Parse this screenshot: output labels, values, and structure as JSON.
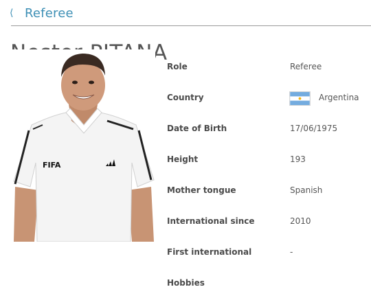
{
  "nav": {
    "back_icon": "chevron-left-icon",
    "back_label": "Referee"
  },
  "referee": {
    "name": "Nestor PITANA",
    "details": [
      {
        "label": "Role",
        "value": "Referee"
      },
      {
        "label": "Country",
        "value": "Argentina"
      },
      {
        "label": "Date of Birth",
        "value": "17/06/1975"
      },
      {
        "label": "Height",
        "value": "193"
      },
      {
        "label": "Mother tongue",
        "value": "Spanish"
      },
      {
        "label": "International since",
        "value": "2010"
      },
      {
        "label": "First international",
        "value": "-"
      },
      {
        "label": "Hobbies",
        "value": ""
      }
    ],
    "photo": {
      "shirt_logo": "FIFA"
    }
  },
  "colors": {
    "accent": "#3d8fb5",
    "flag_blue": "#74acdf",
    "flag_sun": "#f6b40e"
  }
}
